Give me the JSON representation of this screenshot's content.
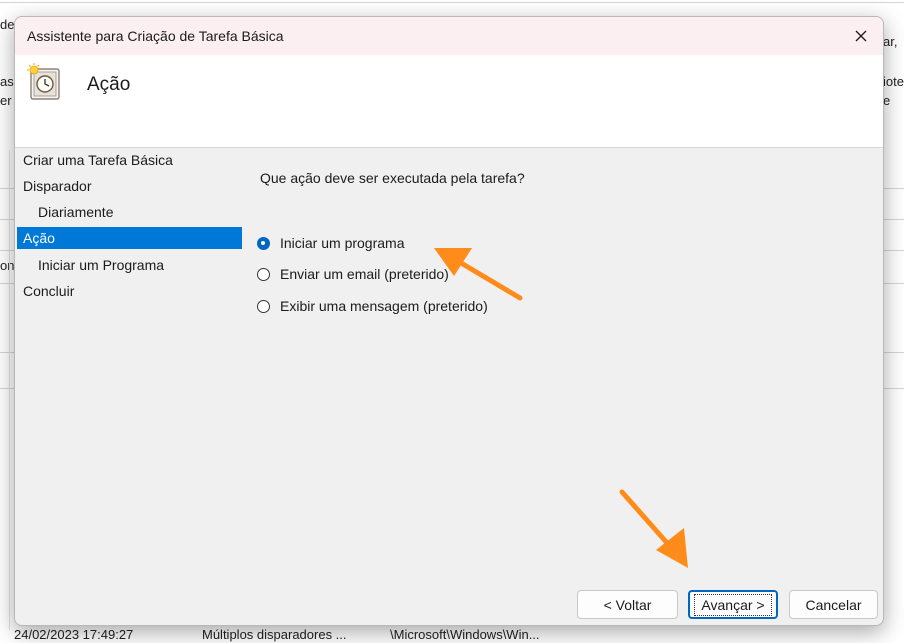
{
  "dialog": {
    "title": "Assistente para Criação de Tarefa Básica",
    "header_title": "Ação",
    "question": "Que ação deve ser executada pela tarefa?"
  },
  "nav": {
    "items": [
      {
        "label": "Criar uma Tarefa Básica",
        "level": 1,
        "selected": false
      },
      {
        "label": "Disparador",
        "level": 1,
        "selected": false
      },
      {
        "label": "Diariamente",
        "level": 2,
        "selected": false
      },
      {
        "label": "Ação",
        "level": 1,
        "selected": true
      },
      {
        "label": "Iniciar um Programa",
        "level": 2,
        "selected": false
      },
      {
        "label": "Concluir",
        "level": 1,
        "selected": false
      }
    ]
  },
  "options": [
    {
      "label": "Iniciar um programa",
      "checked": true
    },
    {
      "label": "Enviar um email (preterido)",
      "checked": false
    },
    {
      "label": "Exibir uma mensagem (preterido)",
      "checked": false
    }
  ],
  "buttons": {
    "back": "< Voltar",
    "next": "Avançar >",
    "cancel": "Cancelar"
  },
  "background": {
    "left_fragments": [
      "de",
      "ast",
      "er",
      "on"
    ],
    "right_fragments": [
      "ar,",
      "iote",
      "e"
    ],
    "status_row": {
      "date": "24/02/2023 17:49:27",
      "triggers": "Múltiplos disparadores ...",
      "path": "\\Microsoft\\Windows\\Win..."
    }
  },
  "colors": {
    "accent": "#0067c0",
    "selection": "#0078d7",
    "arrow": "#ff8c1a",
    "titlebar": "#fbeff1"
  },
  "icons": {
    "header": "scheduled-task-clock-icon",
    "close": "close-icon",
    "annotation": "orange-arrow-icon"
  }
}
